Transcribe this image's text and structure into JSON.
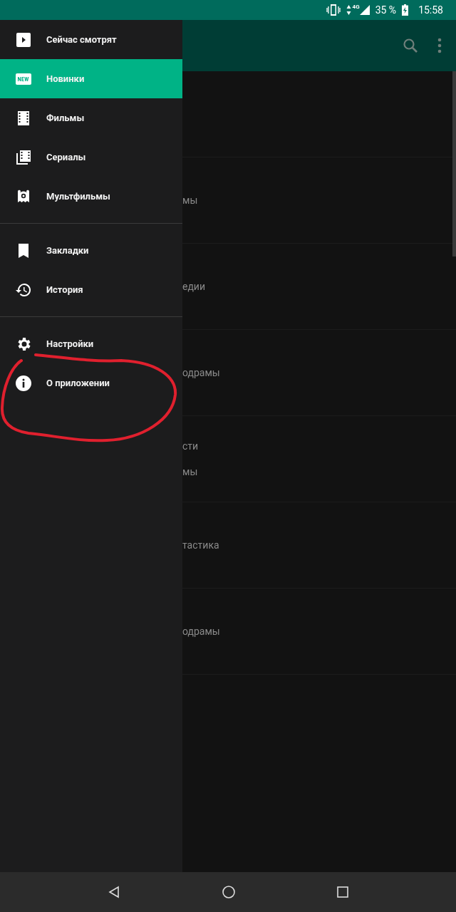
{
  "status_bar": {
    "network": "4G",
    "battery": "35 %",
    "time": "15:58"
  },
  "drawer": {
    "sections": [
      {
        "items": [
          {
            "label": "Сейчас смотрят",
            "selected": false
          },
          {
            "label": "Новинки",
            "selected": true
          },
          {
            "label": "Фильмы",
            "selected": false
          },
          {
            "label": "Сериалы",
            "selected": false
          },
          {
            "label": "Мультфильмы",
            "selected": false
          }
        ]
      },
      {
        "items": [
          {
            "label": "Закладки",
            "selected": false
          },
          {
            "label": "История",
            "selected": false
          }
        ]
      },
      {
        "items": [
          {
            "label": "Настройки",
            "selected": false
          },
          {
            "label": "О приложении",
            "selected": false
          }
        ]
      }
    ]
  },
  "content": {
    "rows": [
      {
        "lines": []
      },
      {
        "lines": [
          "мы"
        ]
      },
      {
        "lines": [
          "едии"
        ]
      },
      {
        "lines": [
          "одрамы"
        ]
      },
      {
        "lines": [
          "сти",
          "мы"
        ]
      },
      {
        "lines": [
          "тастика"
        ]
      },
      {
        "lines": [
          "одрамы"
        ]
      }
    ]
  }
}
